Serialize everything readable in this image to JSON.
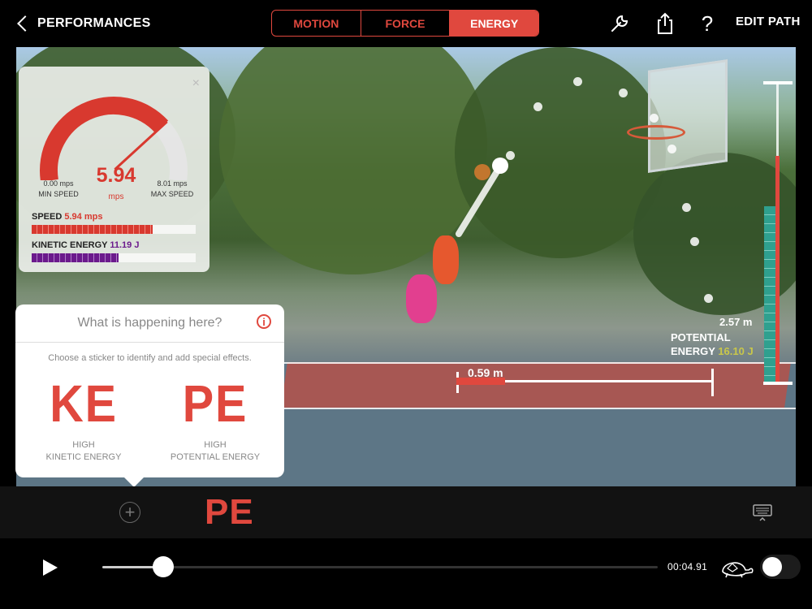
{
  "topbar": {
    "back_label": "PERFORMANCES",
    "tabs": [
      {
        "label": "MOTION",
        "active": false
      },
      {
        "label": "FORCE",
        "active": false
      },
      {
        "label": "ENERGY",
        "active": true
      }
    ],
    "icons": [
      "wrench-icon",
      "share-icon",
      "help-icon"
    ],
    "help_glyph": "?",
    "edit_path_label": "EDIT PATH",
    "accent_color": "#e0483e"
  },
  "speed_panel": {
    "close_glyph": "×",
    "min_value": "0.00 mps",
    "min_label": "MIN SPEED",
    "current_value": "5.94",
    "current_unit": "mps",
    "max_value": "8.01 mps",
    "max_label": "MAX SPEED",
    "gauge_fraction": 0.74,
    "speed_label": "SPEED",
    "speed_value": "5.94 mps",
    "speed_fraction": 0.74,
    "kinetic_label": "KINETIC ENERGY",
    "kinetic_value": "11.19 J",
    "kinetic_fraction": 0.53
  },
  "overlay": {
    "distance_label": "0.59 m",
    "height_label": "2.57 m",
    "potential_label": "POTENTIAL",
    "potential_label2": "ENERGY",
    "potential_value": "16.10 J",
    "potential_fraction": 0.59
  },
  "sticker_panel": {
    "title": "What is happening here?",
    "info_glyph": "i",
    "subtitle": "Choose a sticker to identify and add special effects.",
    "ke_code": "KE",
    "ke_line1": "HIGH",
    "ke_line2": "KINETIC ENERGY",
    "pe_code": "PE",
    "pe_line1": "HIGH",
    "pe_line2": "POTENTIAL ENERGY"
  },
  "tray": {
    "add_glyph": "+",
    "placed_sticker": "PE"
  },
  "player": {
    "time": "00:04.91",
    "progress_fraction": 0.11
  }
}
